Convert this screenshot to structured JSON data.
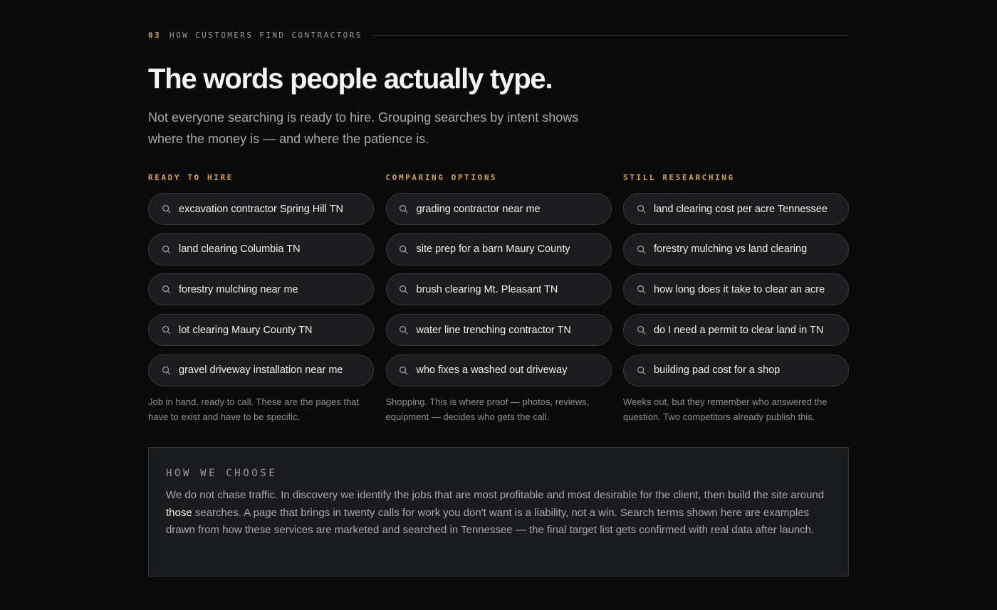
{
  "section": {
    "number": "03",
    "eyebrow": "HOW CUSTOMERS FIND CONTRACTORS"
  },
  "headline": "The words people actually type.",
  "lede": "Not everyone searching is ready to hire. Grouping searches by intent shows where the money is — and where the patience is.",
  "columns": [
    {
      "title": "READY TO HIRE",
      "queries": [
        "excavation contractor Spring Hill TN",
        "land clearing Columbia TN",
        "forestry mulching near me",
        "lot clearing Maury County TN",
        "gravel driveway installation near me"
      ],
      "note": "Job in hand, ready to call. These are the pages that have to exist and have to be specific."
    },
    {
      "title": "COMPARING OPTIONS",
      "queries": [
        "grading contractor near me",
        "site prep for a barn Maury County",
        "brush clearing Mt. Pleasant TN",
        "water line trenching contractor TN",
        "who fixes a washed out driveway"
      ],
      "note": "Shopping. This is where proof — photos, reviews, equipment — decides who gets the call."
    },
    {
      "title": "STILL RESEARCHING",
      "queries": [
        "land clearing cost per acre Tennessee",
        "forestry mulching vs land clearing",
        "how long does it take to clear an acre",
        "do I need a permit to clear land in TN",
        "building pad cost for a shop"
      ],
      "note": "Weeks out, but they remember who answered the question. Two competitors already publish this."
    }
  ],
  "card": {
    "title": "HOW WE CHOOSE",
    "body_before": "We do not chase traffic. In discovery we identify the jobs that are most profitable and most desirable for the client, then build the site around ",
    "body_emphasis": "those",
    "body_after": " searches. A page that brings in twenty calls for work you don't want is a liability, not a win. Search terms shown here are examples drawn from how these services are marketed and searched in Tennessee — the final target list gets confirmed with real data after launch."
  },
  "icons": {
    "pill_icon": "search-icon"
  },
  "colors": {
    "accent": "#d4a04c",
    "background": "#0a0a0b",
    "pill_background": "#1c1c1f",
    "card_background": "#1a1b1d"
  }
}
